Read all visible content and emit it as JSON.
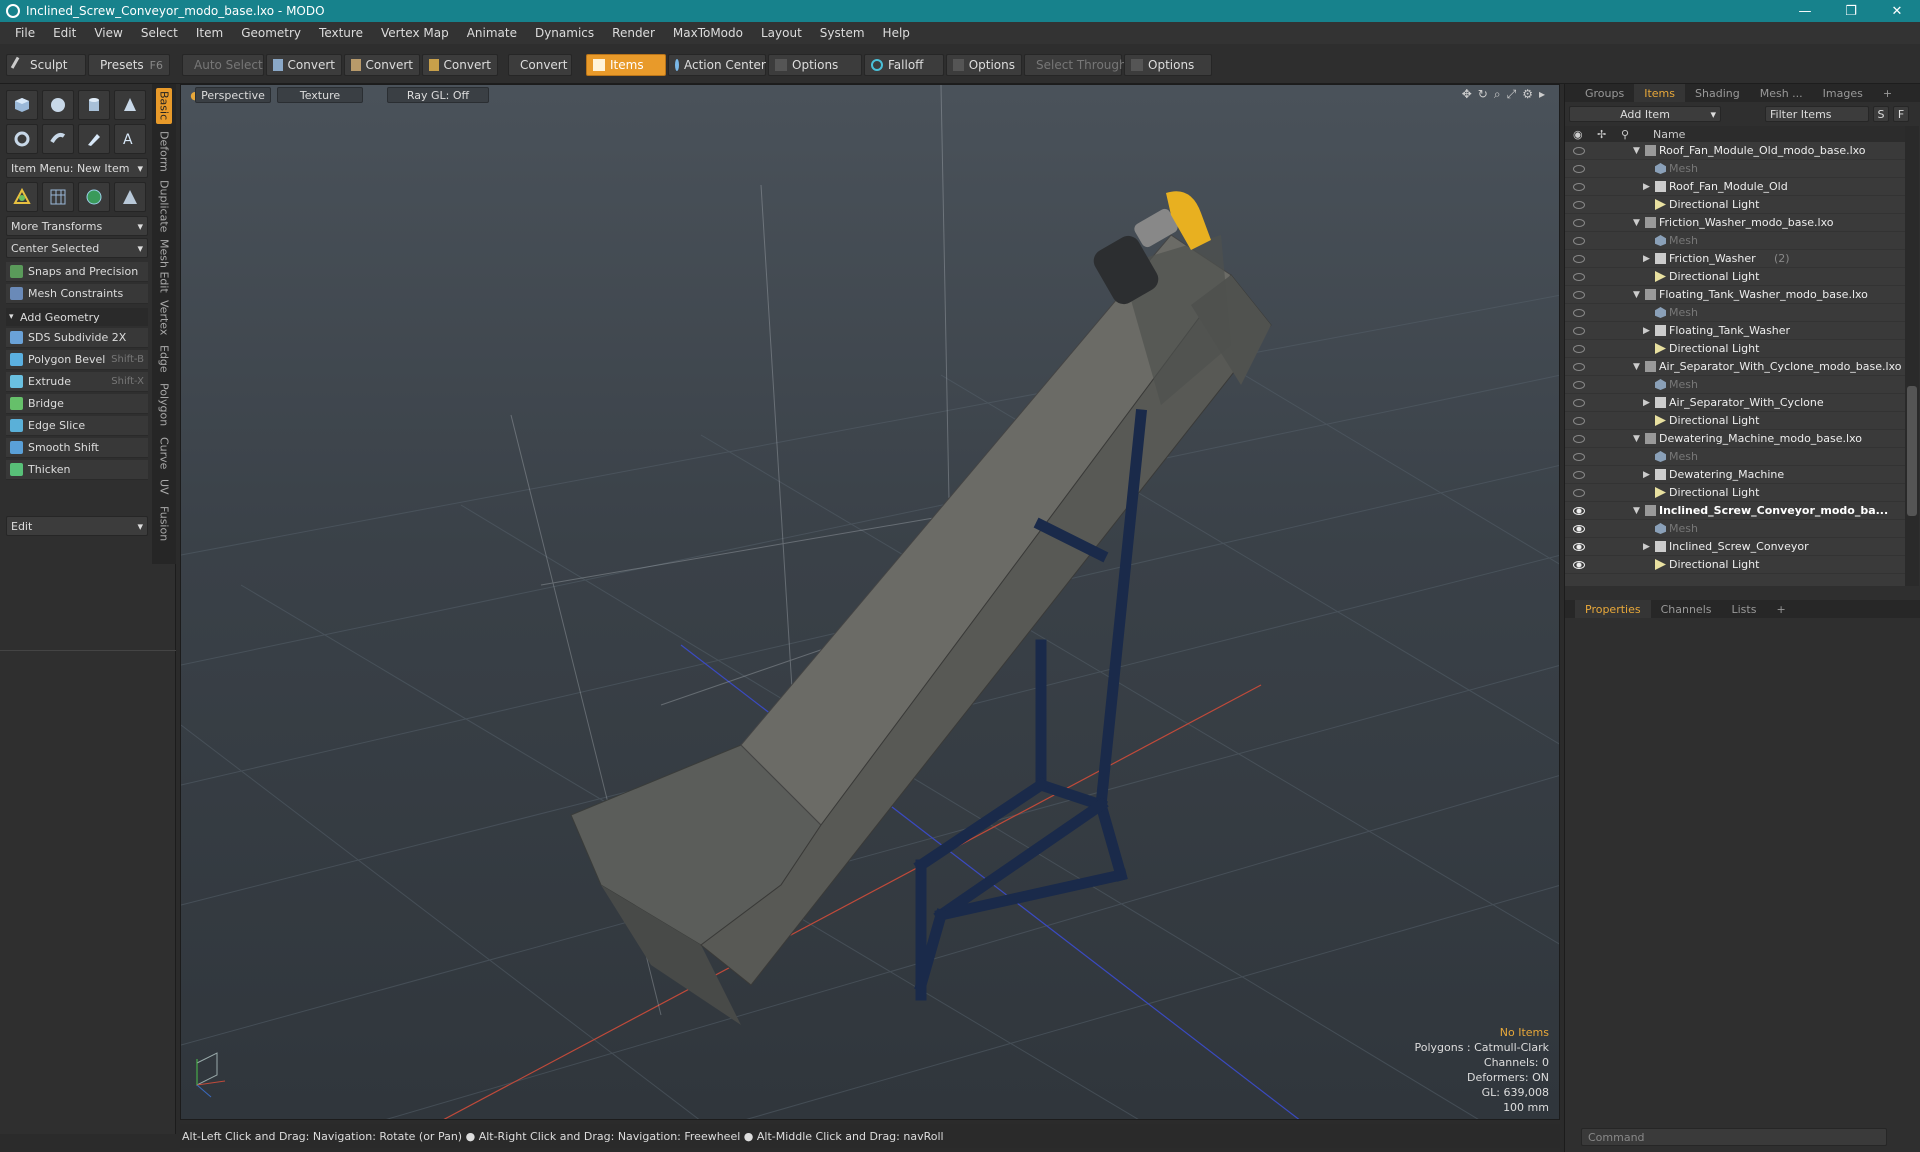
{
  "window": {
    "title": "Inclined_Screw_Conveyor_modo_base.lxo - MODO",
    "minimize": "—",
    "maximize": "❐",
    "close": "✕"
  },
  "menu": [
    "File",
    "Edit",
    "View",
    "Select",
    "Item",
    "Geometry",
    "Texture",
    "Vertex Map",
    "Animate",
    "Dynamics",
    "Render",
    "MaxToModo",
    "Layout",
    "System",
    "Help"
  ],
  "toolbar": {
    "sculpt": "Sculpt",
    "presets": "Presets",
    "presets_key": "F6",
    "auto_select": "Auto Select",
    "convert": "Convert",
    "items": "Items",
    "action_center": "Action Center",
    "options": "Options",
    "falloff": "Falloff",
    "select_through": "Select Through"
  },
  "left": {
    "tabs": [
      "Basic",
      "Deform",
      "Duplicate",
      "Mesh Edit",
      "Vertex",
      "Edge",
      "Polygon",
      "Curve",
      "UV",
      "Fusion"
    ],
    "item_menu": "Item Menu: New Item",
    "more_transforms": "More Transforms",
    "center_selected": "Center Selected",
    "snaps": "Snaps and Precision",
    "constraints": "Mesh Constraints",
    "add_geometry": "Add Geometry",
    "tools": [
      {
        "label": "SDS Subdivide 2X",
        "key": "",
        "color": "#6aa2d8"
      },
      {
        "label": "Polygon Bevel",
        "key": "Shift-B",
        "color": "#5bb0e0"
      },
      {
        "label": "Extrude",
        "key": "Shift-X",
        "color": "#6ac0e0"
      },
      {
        "label": "Bridge",
        "key": "",
        "color": "#66c06a"
      },
      {
        "label": "Edge Slice",
        "key": "",
        "color": "#5ab0d8"
      },
      {
        "label": "Smooth Shift",
        "key": "",
        "color": "#5aa0d8"
      },
      {
        "label": "Thicken",
        "key": "",
        "color": "#58c078"
      }
    ],
    "edit": "Edit"
  },
  "viewport": {
    "view": "Perspective",
    "shading": "Texture",
    "raygl": "Ray GL: Off",
    "stats": {
      "selection": "No Items",
      "polygons": "Polygons : Catmull-Clark",
      "channels": "Channels: 0",
      "deformers": "Deformers: ON",
      "gl": "GL: 639,008",
      "units": "100 mm"
    }
  },
  "status": "Alt-Left Click and Drag: Navigation: Rotate (or Pan) ● Alt-Right Click and Drag: Navigation: Freewheel ● Alt-Middle Click and Drag: navRoll",
  "right": {
    "tabs": [
      "Groups",
      "Items",
      "Shading",
      "Mesh ...",
      "Images"
    ],
    "add_item": "Add Item",
    "filter": "Filter Items",
    "s_btn": "S",
    "f_btn": "F",
    "name_col": "Name",
    "tree": [
      {
        "label": "Roof_Fan_Module_Old_modo_base.lxo",
        "type": "scene",
        "depth": 0
      },
      {
        "label": "Mesh",
        "type": "mesh",
        "depth": 1
      },
      {
        "label": "Roof_Fan_Module_Old",
        "type": "group",
        "depth": 1
      },
      {
        "label": "Directional Light",
        "type": "light",
        "depth": 1
      },
      {
        "label": "Friction_Washer_modo_base.lxo",
        "type": "scene",
        "depth": 0
      },
      {
        "label": "Mesh",
        "type": "mesh",
        "depth": 1
      },
      {
        "label": "Friction_Washer",
        "type": "group",
        "depth": 1,
        "count": "(2)"
      },
      {
        "label": "Directional Light",
        "type": "light",
        "depth": 1
      },
      {
        "label": "Floating_Tank_Washer_modo_base.lxo",
        "type": "scene",
        "depth": 0
      },
      {
        "label": "Mesh",
        "type": "mesh",
        "depth": 1
      },
      {
        "label": "Floating_Tank_Washer",
        "type": "group",
        "depth": 1
      },
      {
        "label": "Directional Light",
        "type": "light",
        "depth": 1
      },
      {
        "label": "Air_Separator_With_Cyclone_modo_base.lxo",
        "type": "scene",
        "depth": 0
      },
      {
        "label": "Mesh",
        "type": "mesh",
        "depth": 1
      },
      {
        "label": "Air_Separator_With_Cyclone",
        "type": "group",
        "depth": 1
      },
      {
        "label": "Directional Light",
        "type": "light",
        "depth": 1
      },
      {
        "label": "Dewatering_Machine_modo_base.lxo",
        "type": "scene",
        "depth": 0
      },
      {
        "label": "Mesh",
        "type": "mesh",
        "depth": 1
      },
      {
        "label": "Dewatering_Machine",
        "type": "group",
        "depth": 1
      },
      {
        "label": "Directional Light",
        "type": "light",
        "depth": 1
      },
      {
        "label": "Inclined_Screw_Conveyor_modo_ba...",
        "type": "scene",
        "depth": 0,
        "bold": true
      },
      {
        "label": "Mesh",
        "type": "mesh",
        "depth": 1
      },
      {
        "label": "Inclined_Screw_Conveyor",
        "type": "group",
        "depth": 1
      },
      {
        "label": "Directional Light",
        "type": "light",
        "depth": 1
      }
    ],
    "props_tabs": [
      "Properties",
      "Channels",
      "Lists"
    ],
    "command": "Command"
  },
  "colors": {
    "accent": "#e89a2a",
    "titlebar": "#17828c",
    "stand": "#1a2a4a",
    "conveyor": "#6b6b66",
    "motor_cap": "#e8b020"
  }
}
